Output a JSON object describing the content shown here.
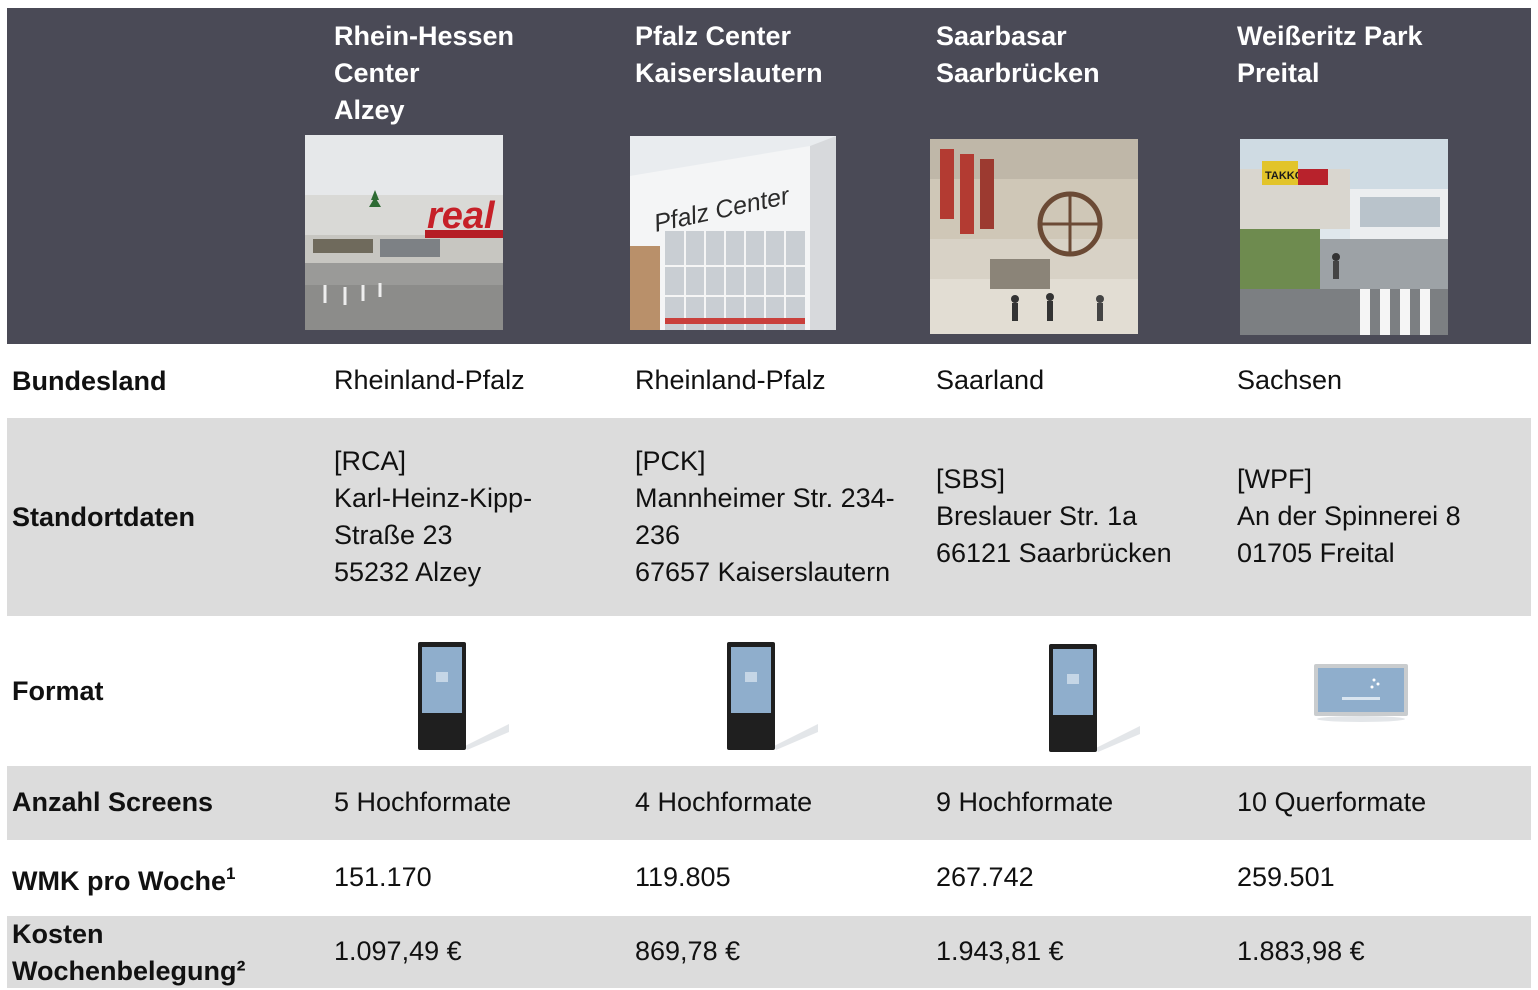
{
  "centers": [
    {
      "name_lines": [
        "Rhein-Hessen",
        "Center",
        "Alzey"
      ],
      "photo_icon": "mall-photo-real-storefront",
      "bundesland": "Rheinland-Pfalz",
      "standort_lines": [
        "[RCA]",
        "Karl-Heinz-Kipp-",
        "Straße 23",
        "55232 Alzey"
      ],
      "format_icon": "portrait-screen-icon",
      "screens": "5 Hochformate",
      "wmk": "151.170",
      "kosten": "1.097,49 €"
    },
    {
      "name_lines": [
        "Pfalz Center",
        "Kaiserslautern"
      ],
      "photo_icon": "mall-photo-pfalz-center-facade",
      "bundesland": "Rheinland-Pfalz",
      "standort_lines": [
        "[PCK]",
        "Mannheimer Str. 234-",
        "236",
        "67657 Kaiserslautern"
      ],
      "format_icon": "portrait-screen-icon",
      "screens": "4 Hochformate",
      "wmk": "119.805",
      "kosten": "869,78 €"
    },
    {
      "name_lines": [
        "Saarbasar",
        "Saarbrücken"
      ],
      "photo_icon": "mall-photo-interior-atrium",
      "bundesland": "Saarland",
      "standort_lines": [
        "[SBS]",
        "Breslauer Str. 1a",
        "66121 Saarbrücken"
      ],
      "format_icon": "portrait-screen-icon",
      "screens": "9 Hochformate",
      "wmk": "267.742",
      "kosten": "1.943,81 €"
    },
    {
      "name_lines": [
        "Weißeritz Park",
        "Preital"
      ],
      "photo_icon": "mall-photo-takko-storefront",
      "bundesland": "Sachsen",
      "standort_lines": [
        "[WPF]",
        "An der Spinnerei 8",
        "01705 Freital"
      ],
      "format_icon": "landscape-screen-icon",
      "screens": "10 Querformate",
      "wmk": "259.501",
      "kosten": "1.883,98 €"
    }
  ],
  "labels": {
    "bundesland": "Bundesland",
    "standort": "Standortdaten",
    "format": "Format",
    "screens": "Anzahl Screens",
    "wmk": "WMK pro Woche",
    "wmk_footnote": "1",
    "kosten_line1": "Kosten",
    "kosten_line2": "Wochenbelegung²"
  },
  "photo_text": {
    "real_logo": "real",
    "pfalz_center": "Pfalz Center",
    "takko": "TAKKO"
  },
  "colors": {
    "header_bg": "#4a4a56",
    "shaded_row": "#dcdcdc",
    "header_text": "#ffffff"
  }
}
